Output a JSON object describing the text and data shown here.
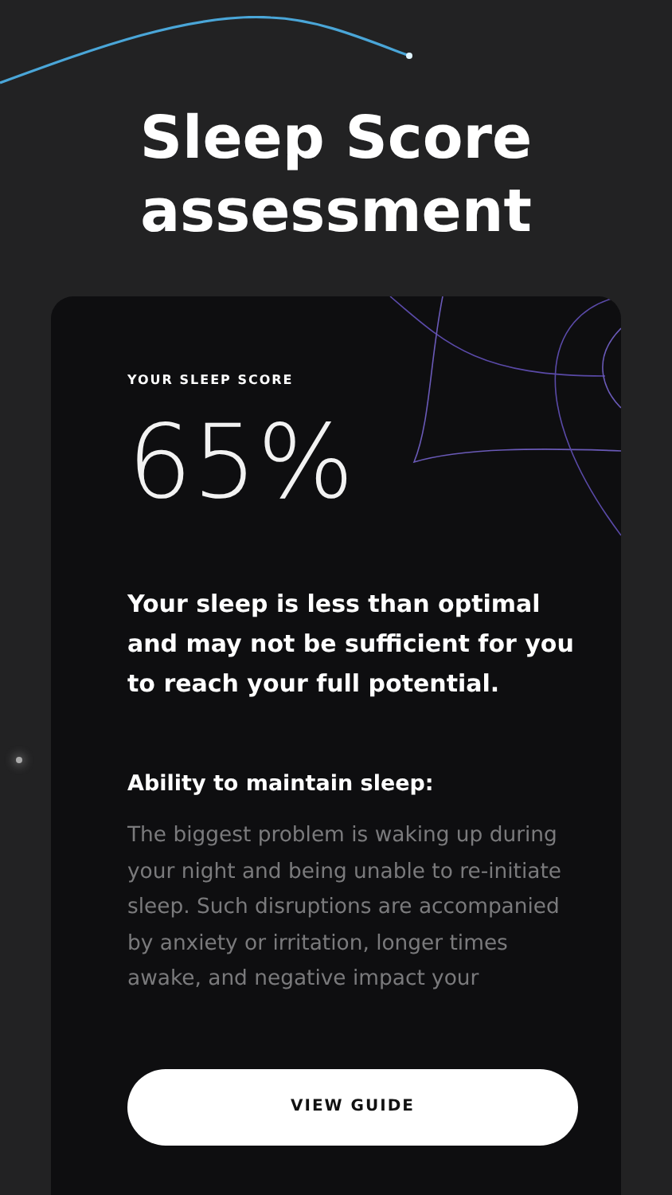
{
  "title": "Sleep Score assessment",
  "card": {
    "label": "YOUR SLEEP SCORE",
    "score": "65%",
    "summary": "Your sleep is less than optimal and may not be sufficient for you to reach your full potential.",
    "section_title": "Ability to maintain sleep:",
    "section_text": "The biggest problem is waking up during your night and being unable to re-initiate sleep. Such disruptions are accompanied by anxiety or irritation, longer times awake, and negative impact your",
    "button": "VIEW GUIDE"
  }
}
